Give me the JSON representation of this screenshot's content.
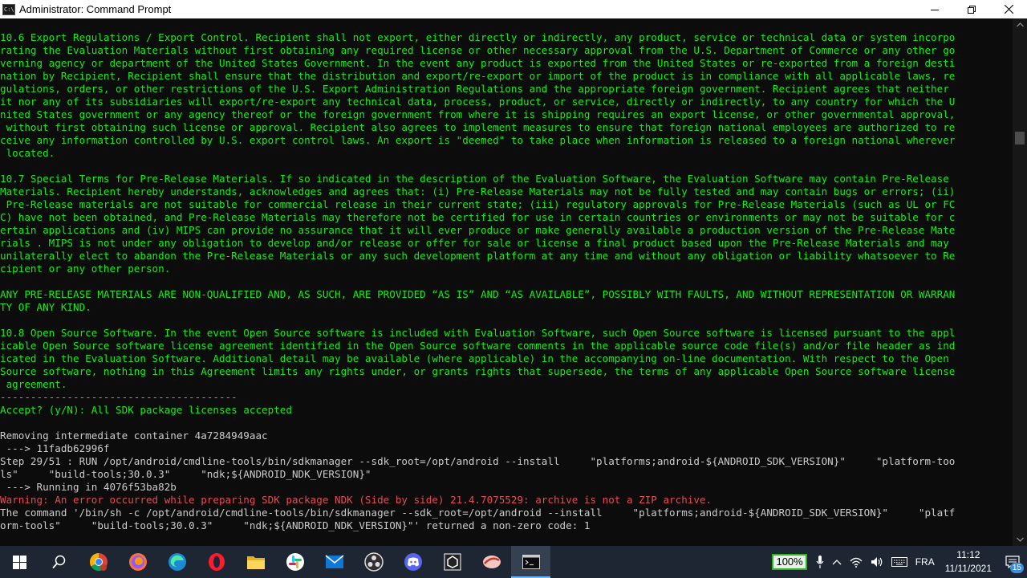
{
  "window": {
    "title": "Administrator: Command Prompt",
    "icon_label": "C:\\"
  },
  "console_lines": [
    {
      "text": "10.6 Export Regulations / Export Control. Recipient shall not export, either directly or indirectly, any product, service or technical data or system incorpo",
      "color": "green"
    },
    {
      "text": "rating the Evaluation Materials without first obtaining any required license or other necessary approval from the U.S. Department of Commerce or any other go",
      "color": "green"
    },
    {
      "text": "verning agency or department of the United States Government. In the event any product is exported from the United States or re-exported from a foreign desti",
      "color": "green"
    },
    {
      "text": "nation by Recipient, Recipient shall ensure that the distribution and export/re-export or import of the product is in compliance with all applicable laws, re",
      "color": "green"
    },
    {
      "text": "gulations, orders, or other restrictions of the U.S. Export Administration Regulations and the appropriate foreign government. Recipient agrees that neither",
      "color": "green"
    },
    {
      "text": "it nor any of its subsidiaries will export/re-export any technical data, process, product, or service, directly or indirectly, to any country for which the U",
      "color": "green"
    },
    {
      "text": "nited States government or any agency thereof or the foreign government from where it is shipping requires an export license, or other governmental approval,",
      "color": "green"
    },
    {
      "text": " without first obtaining such license or approval. Recipient also agrees to implement measures to ensure that foreign national employees are authorized to re",
      "color": "green"
    },
    {
      "text": "ceive any information controlled by U.S. export control laws. An export is \"deemed\" to take place when information is released to a foreign national wherever",
      "color": "green"
    },
    {
      "text": " located.",
      "color": "green"
    },
    {
      "text": "",
      "color": "green"
    },
    {
      "text": "10.7 Special Terms for Pre-Release Materials. If so indicated in the description of the Evaluation Software, the Evaluation Software may contain Pre-Release",
      "color": "green"
    },
    {
      "text": "Materials. Recipient hereby understands, acknowledges and agrees that: (i) Pre-Release Materials may not be fully tested and may contain bugs or errors; (ii)",
      "color": "green"
    },
    {
      "text": " Pre-Release materials are not suitable for commercial release in their current state; (iii) regulatory approvals for Pre-Release Materials (such as UL or FC",
      "color": "green"
    },
    {
      "text": "C) have not been obtained, and Pre-Release Materials may therefore not be certified for use in certain countries or environments or may not be suitable for c",
      "color": "green"
    },
    {
      "text": "ertain applications and (iv) MIPS can provide no assurance that it will ever produce or make generally available a production version of the Pre-Release Mate",
      "color": "green"
    },
    {
      "text": "rials . MIPS is not under any obligation to develop and/or release or offer for sale or license a final product based upon the Pre-Release Materials and may",
      "color": "green"
    },
    {
      "text": "unilaterally elect to abandon the Pre-Release Materials or any such development platform at any time and without any obligation or liability whatsoever to Re",
      "color": "green"
    },
    {
      "text": "cipient or any other person.",
      "color": "green"
    },
    {
      "text": "",
      "color": "green"
    },
    {
      "text": "ANY PRE-RELEASE MATERIALS ARE NON-QUALIFIED AND, AS SUCH, ARE PROVIDED “AS IS” AND “AS AVAILABLE”, POSSIBLY WITH FAULTS, AND WITHOUT REPRESENTATION OR WARRAN",
      "color": "green"
    },
    {
      "text": "TY OF ANY KIND.",
      "color": "green"
    },
    {
      "text": "",
      "color": "green"
    },
    {
      "text": "10.8 Open Source Software. In the event Open Source software is included with Evaluation Software, such Open Source software is licensed pursuant to the appl",
      "color": "green"
    },
    {
      "text": "icable Open Source software license agreement identified in the Open Source software comments in the applicable source code file(s) and/or file header as ind",
      "color": "green"
    },
    {
      "text": "icated in the Evaluation Software. Additional detail may be available (where applicable) in the accompanying on-line documentation. With respect to the Open",
      "color": "green"
    },
    {
      "text": "Source software, nothing in this Agreement limits any rights under, or grants rights that supersede, the terms of any applicable Open Source software license",
      "color": "green"
    },
    {
      "text": " agreement.",
      "color": "green"
    },
    {
      "text": "---------------------------------------",
      "color": "green"
    },
    {
      "text": "Accept? (y/N): All SDK package licenses accepted",
      "color": "green"
    },
    {
      "text": "",
      "color": "green"
    },
    {
      "text": "Removing intermediate container 4a7284949aac",
      "color": "white"
    },
    {
      "text": " ---> 11fadb62996f",
      "color": "white"
    },
    {
      "text": "Step 29/51 : RUN /opt/android/cmdline-tools/bin/sdkmanager --sdk_root=/opt/android --install     \"platforms;android-${ANDROID_SDK_VERSION}\"     \"platform-too",
      "color": "white"
    },
    {
      "text": "ls\"     \"build-tools;30.0.3\"     \"ndk;${ANDROID_NDK_VERSION}\"",
      "color": "white"
    },
    {
      "text": " ---> Running in 4076f53ba82b",
      "color": "white"
    },
    {
      "text": "Warning: An error occurred while preparing SDK package NDK (Side by side) 21.4.7075529: archive is not a ZIP archive.",
      "color": "red"
    },
    {
      "text": "The command '/bin/sh -c /opt/android/cmdline-tools/bin/sdkmanager --sdk_root=/opt/android --install     \"platforms;android-${ANDROID_SDK_VERSION}\"     \"platf",
      "color": "white"
    },
    {
      "text": "orm-tools\"     \"build-tools;30.0.3\"     \"ndk;${ANDROID_NDK_VERSION}\"' returned a non-zero code: 1",
      "color": "white"
    }
  ],
  "colors": {
    "green": "#13ed13",
    "white": "#cccccc",
    "red": "#e74856"
  },
  "taskbar": {
    "apps": [
      {
        "name": "start-button",
        "icon": "windows-logo"
      },
      {
        "name": "search-button",
        "icon": "search-icon"
      },
      {
        "name": "chrome-button",
        "icon": "chrome-icon"
      },
      {
        "name": "firefox-button",
        "icon": "firefox-icon"
      },
      {
        "name": "edge-button",
        "icon": "edge-icon"
      },
      {
        "name": "opera-button",
        "icon": "opera-icon"
      },
      {
        "name": "file-explorer-button",
        "icon": "folder-icon"
      },
      {
        "name": "slack-button",
        "icon": "slack-icon"
      },
      {
        "name": "mail-button",
        "icon": "mail-icon"
      },
      {
        "name": "obs-button",
        "icon": "obs-icon"
      },
      {
        "name": "discord-button",
        "icon": "discord-icon"
      },
      {
        "name": "unity-button",
        "icon": "unity-icon"
      },
      {
        "name": "game-app-button",
        "icon": "game-icon"
      },
      {
        "name": "command-prompt-button",
        "icon": "terminal-icon",
        "active": true
      }
    ],
    "battery_label": "100%",
    "language": "FRA",
    "time": "11:12",
    "date": "11/11/2021",
    "notification_count": "15"
  }
}
